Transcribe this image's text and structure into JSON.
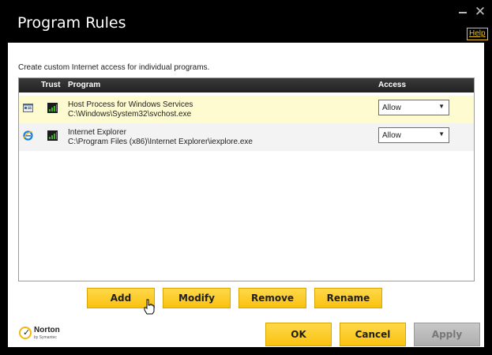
{
  "window": {
    "title": "Program Rules",
    "help_label": "Help",
    "minimize_icon": "minimize-icon",
    "close_icon": "close-icon"
  },
  "description": "Create custom Internet access for individual programs.",
  "table": {
    "headers": {
      "trust": "Trust",
      "program": "Program",
      "access": "Access"
    },
    "rows": [
      {
        "name": "Host Process for Windows Services",
        "path": "C:\\Windows\\System32\\svchost.exe",
        "icon": "window-app-icon",
        "trust_icon": "trust-level-icon",
        "access": "Allow",
        "selected": true
      },
      {
        "name": "Internet Explorer",
        "path": "C:\\Program Files (x86)\\Internet Explorer\\iexplore.exe",
        "icon": "internet-explorer-icon",
        "trust_icon": "trust-level-icon",
        "access": "Allow",
        "selected": false
      }
    ]
  },
  "buttons": {
    "add": "Add",
    "modify": "Modify",
    "remove": "Remove",
    "rename": "Rename",
    "ok": "OK",
    "cancel": "Cancel",
    "apply": "Apply"
  },
  "logo": {
    "name": "Norton",
    "sub": "by Symantec"
  },
  "colors": {
    "accent": "#f9c20f",
    "selected_row": "#fdfbcf",
    "header": "#222222",
    "trust_green": "#3fae29"
  }
}
